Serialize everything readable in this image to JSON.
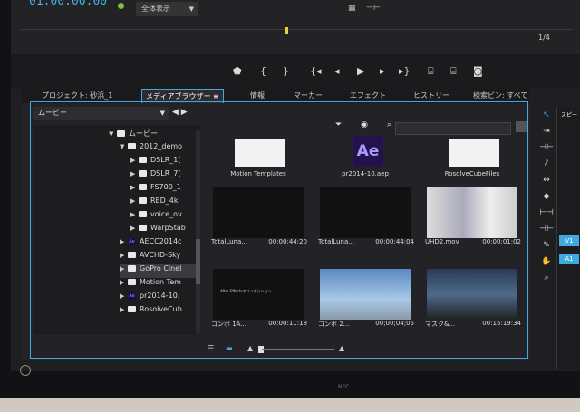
{
  "monitor": {
    "timecode": "01:00:00:00",
    "zoom_value": "全体表示",
    "page": "1/4"
  },
  "tabs": [
    {
      "label": "プロジェクト: 砂浜_1",
      "active": false
    },
    {
      "label": "メディアブラウザー",
      "active": true
    },
    {
      "label": "情報",
      "active": false
    },
    {
      "label": "マーカー",
      "active": false
    },
    {
      "label": "エフェクト",
      "active": false
    },
    {
      "label": "ヒストリー",
      "active": false
    },
    {
      "label": "検索ビン: すべて",
      "active": false
    }
  ],
  "tab_menu_icon": "hamburger-icon",
  "browser": {
    "location": "ムービー",
    "tree": [
      {
        "label": "ムービー",
        "kind": "folder",
        "depth": 0
      },
      {
        "label": "2012_demo",
        "kind": "folder",
        "depth": 1
      },
      {
        "label": "DSLR_1(",
        "kind": "folder",
        "depth": 2
      },
      {
        "label": "DSLR_7(",
        "kind": "folder",
        "depth": 2
      },
      {
        "label": "FS700_1",
        "kind": "folder",
        "depth": 2
      },
      {
        "label": "RED_4k",
        "kind": "folder",
        "depth": 2
      },
      {
        "label": "voice_ov",
        "kind": "folder",
        "depth": 2
      },
      {
        "label": "WarpStab",
        "kind": "folder",
        "depth": 2
      },
      {
        "label": "AECC2014c",
        "kind": "ae",
        "depth": 1
      },
      {
        "label": "AVCHD-Sky",
        "kind": "folder",
        "depth": 1
      },
      {
        "label": "GoPro Cinel",
        "kind": "folder",
        "depth": 1,
        "selected": true
      },
      {
        "label": "Motion Tem",
        "kind": "folder",
        "depth": 1
      },
      {
        "label": "pr2014-10.",
        "kind": "ae",
        "depth": 1
      },
      {
        "label": "RosolveCub",
        "kind": "folder",
        "depth": 1
      }
    ],
    "items": [
      {
        "name": "Motion Templates",
        "duration": "",
        "type": "folder"
      },
      {
        "name": "pr2014-10.aep",
        "duration": "",
        "type": "ae"
      },
      {
        "name": "RosolveCubeFiles",
        "duration": "",
        "type": "folder"
      },
      {
        "name": "TotalLuna...",
        "duration": "00;00;44;20",
        "type": "black"
      },
      {
        "name": "TotalLuna...",
        "duration": "00;00;44;04",
        "type": "black"
      },
      {
        "name": "UHD2.mov",
        "duration": "00:00:01:02",
        "type": "photo"
      },
      {
        "name": "コンポ 1A...",
        "duration": "00:00:11:18",
        "type": "text",
        "thumb_text": "After Effectsのコンポジション"
      },
      {
        "name": "コンポ 2...",
        "duration": "00;00;04;05",
        "type": "sky"
      },
      {
        "name": "マスク&...",
        "duration": "00:15:19:34",
        "type": "ui"
      }
    ],
    "ae_label": "Ae"
  },
  "colors": {
    "accent": "#3fa9e0",
    "playhead": "#e6d33a",
    "track_v1": "#3fa9e0"
  },
  "right_panel": {
    "title": "スピー",
    "tracks": [
      "V1",
      "A1"
    ]
  },
  "device": {
    "brand": "NEC"
  }
}
